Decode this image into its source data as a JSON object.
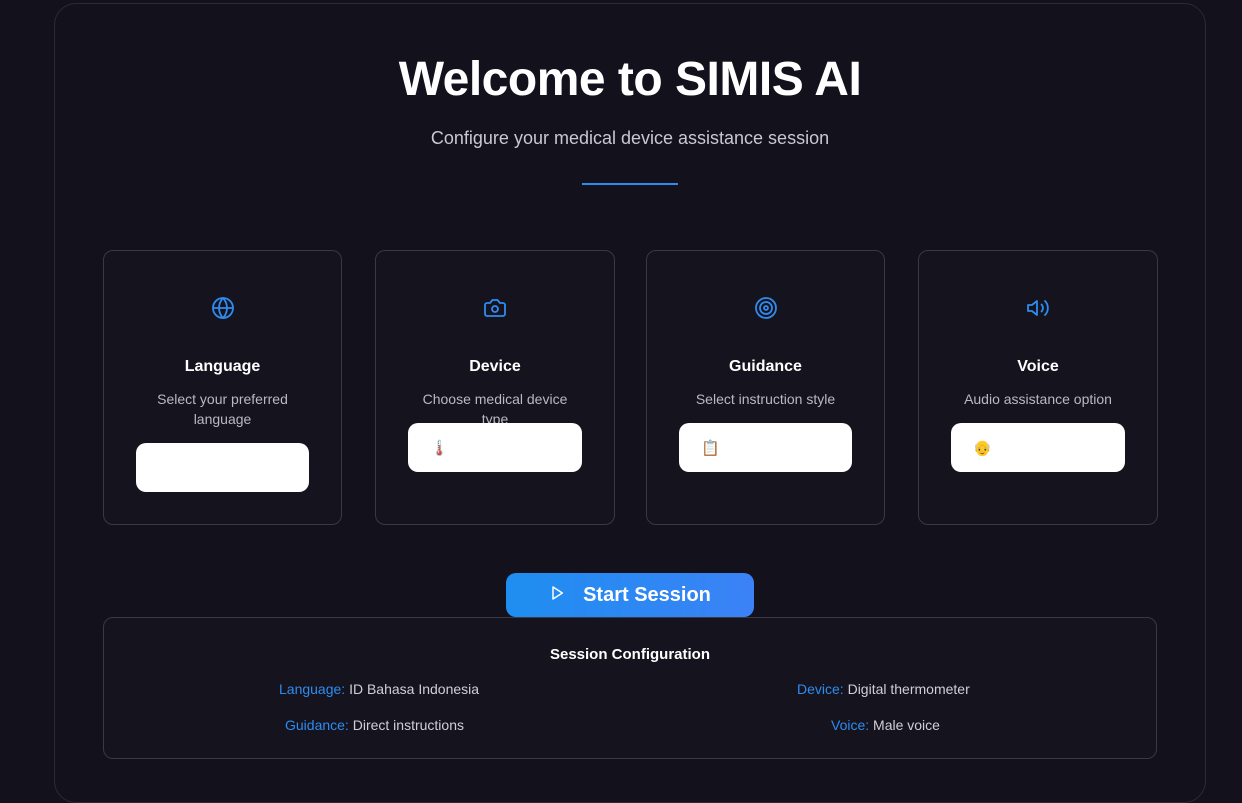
{
  "header": {
    "title": "Welcome to SIMIS AI",
    "subtitle": "Configure your medical device assistance session"
  },
  "cards": [
    {
      "title": "Language",
      "description": "Select your preferred language",
      "icon": "globe-icon",
      "select_value": ""
    },
    {
      "title": "Device",
      "description": "Choose medical device type",
      "icon": "camera-icon",
      "select_value": "🌡️"
    },
    {
      "title": "Guidance",
      "description": "Select instruction style",
      "icon": "target-icon",
      "select_value": "📋"
    },
    {
      "title": "Voice",
      "description": "Audio assistance option",
      "icon": "speaker-icon",
      "select_value": "👴"
    }
  ],
  "start_button": {
    "label": "Start Session",
    "icon": "play-icon"
  },
  "summary": {
    "title": "Session Configuration",
    "language_key": "Language:",
    "language_value": "ID Bahasa Indonesia",
    "device_key": "Device:",
    "device_value": "Digital thermometer",
    "guidance_key": "Guidance:",
    "guidance_value": "Direct instructions",
    "voice_key": "Voice:",
    "voice_value": "Male voice"
  },
  "colors": {
    "accent": "#2e8cf0",
    "background": "#13111c",
    "card_border": "#3a3846"
  }
}
